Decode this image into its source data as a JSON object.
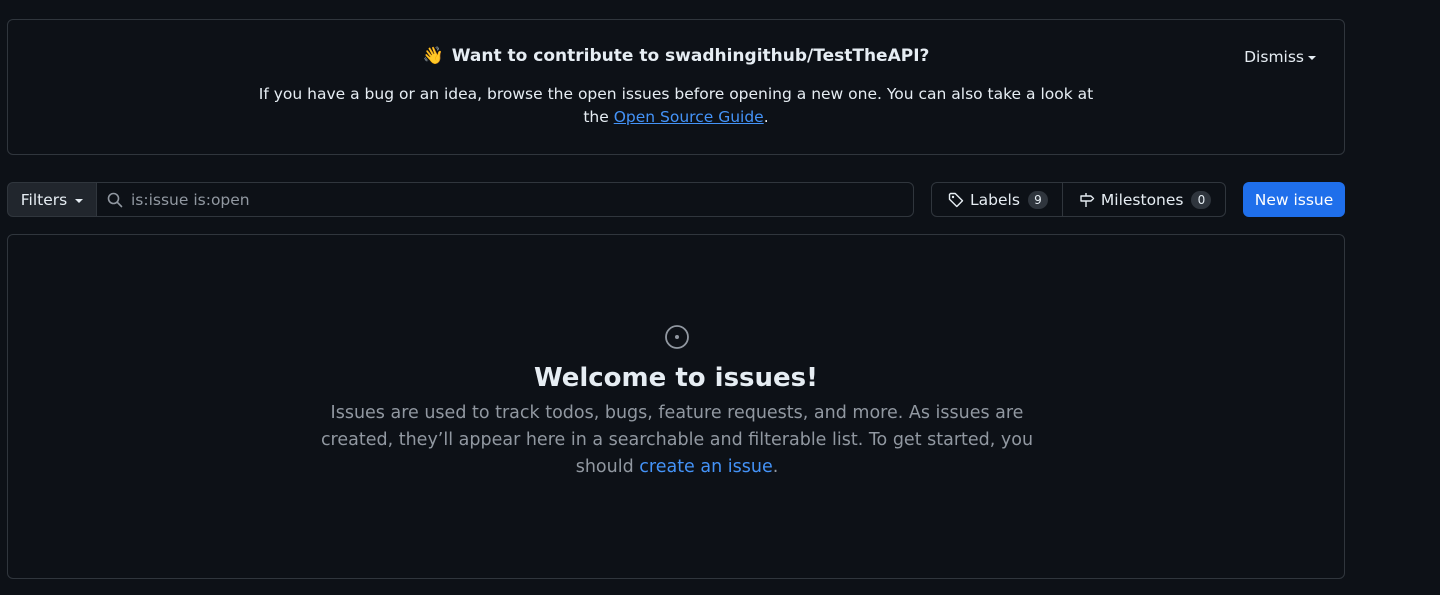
{
  "banner": {
    "emoji": "👋",
    "title": "Want to contribute to swadhingithub/TestTheAPI?",
    "text_before": "If you have a bug or an idea, browse the open issues before opening a new one. You can also take a look at the",
    "link": "Open Source Guide",
    "text_after": ".",
    "dismiss_label": "Dismiss"
  },
  "toolbar": {
    "filters_label": "Filters",
    "search_value": "is:issue is:open",
    "labels_label": "Labels",
    "labels_count": "9",
    "milestones_label": "Milestones",
    "milestones_count": "0",
    "new_issue_label": "New issue"
  },
  "blankslate": {
    "title": "Welcome to issues!",
    "text_before": "Issues are used to track todos, bugs, feature requests, and more. As issues are created, they’ll appear here in a searchable and filterable list. To get started, you should",
    "link": "create an issue",
    "text_after": "."
  },
  "colors": {
    "background": "#0d1117",
    "border": "#30363d",
    "link": "#4493f8",
    "primary_button": "#1f6feb"
  }
}
